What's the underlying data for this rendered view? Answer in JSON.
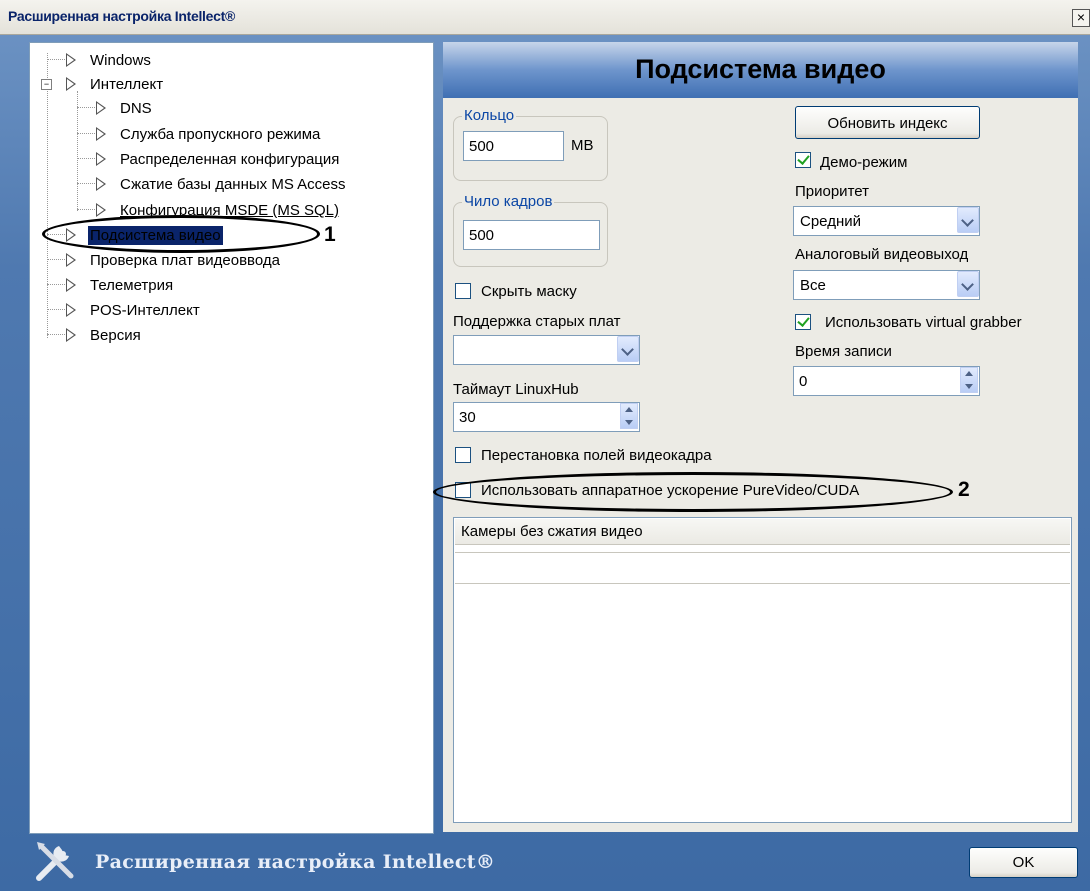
{
  "window": {
    "title": "Расширенная настройка Intellect®",
    "close_glyph": "×"
  },
  "tree": {
    "items": [
      {
        "label": "Windows"
      },
      {
        "label": "Интеллект"
      },
      {
        "label": "DNS"
      },
      {
        "label": "Служба пропускного режима"
      },
      {
        "label": "Распределенная конфигурация"
      },
      {
        "label": "Сжатие базы данных MS Access"
      },
      {
        "label": "Конфигурация MSDE (MS SQL)"
      },
      {
        "label": "Подсистема видео",
        "selected": true
      },
      {
        "label": "Проверка плат видеоввода"
      },
      {
        "label": "Телеметрия"
      },
      {
        "label": "POS-Интеллект"
      },
      {
        "label": "Версия"
      }
    ],
    "expand_glyph": "−"
  },
  "panel": {
    "title": "Подсистема видео",
    "ring": {
      "group_label": "Кольцо",
      "value": "500",
      "unit": "MB"
    },
    "frames": {
      "group_label": "Чило кадров",
      "value": "500"
    },
    "hide_mask": {
      "label": "Скрыть маску",
      "checked": false
    },
    "old_boards": {
      "label": "Поддержка старых плат",
      "value": ""
    },
    "linuxhub": {
      "label": "Таймаут LinuxHub",
      "value": "30"
    },
    "field_swap": {
      "label": "Перестановка полей видеокадра",
      "checked": false
    },
    "hw_accel": {
      "label": "Использовать аппаратное ускорение PureVideo/CUDA",
      "checked": false
    },
    "refresh_button": "Обновить индекс",
    "demo": {
      "label": "Демо-режим",
      "checked": true
    },
    "priority": {
      "label": "Приоритет",
      "value": "Средний"
    },
    "analog_out": {
      "label": "Аналоговый видеовыход",
      "value": "Все"
    },
    "virtual_grabber": {
      "label": "Использовать virtual grabber",
      "checked": true
    },
    "record_time": {
      "label": "Время записи",
      "value": "0"
    },
    "cameras_list": {
      "header": "Камеры без сжатия видео"
    }
  },
  "annotations": {
    "callout_1": "1",
    "callout_2": "2"
  },
  "footer": {
    "app_name": "Расширенная настройка Intellect®",
    "ok_button": "OK",
    "icon": "tools-icon"
  }
}
